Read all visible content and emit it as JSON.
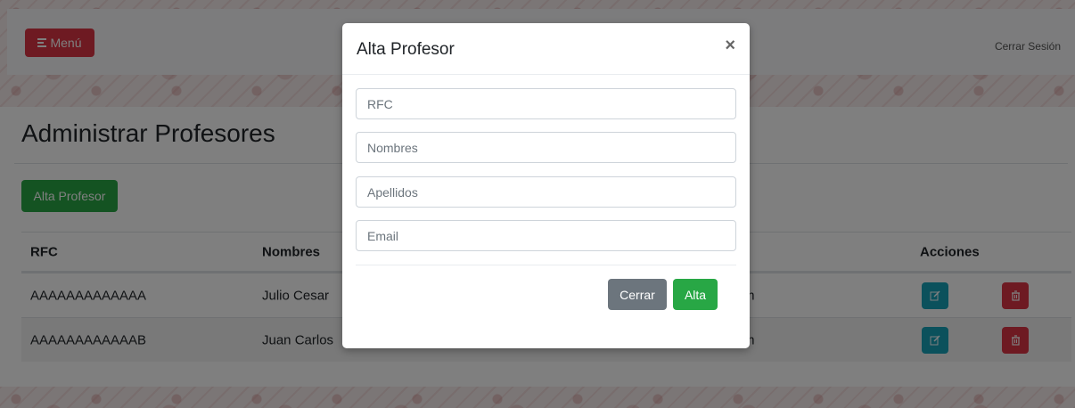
{
  "header": {
    "menu_label": "Menú",
    "logout_label": "Cerrar Sesión"
  },
  "page": {
    "title": "Administrar Profesores",
    "add_button_label": "Alta Profesor"
  },
  "table": {
    "headers": {
      "rfc": "RFC",
      "nombres": "Nombres",
      "acciones": "Acciones"
    },
    "rows": [
      {
        "rfc": "AAAAAAAAAAAAA",
        "nombres": "Julio Cesar",
        "email_fragment": "m"
      },
      {
        "rfc": "AAAAAAAAAAAAB",
        "nombres": "Juan Carlos",
        "email_fragment": "m"
      }
    ]
  },
  "modal": {
    "title": "Alta Profesor",
    "close_symbol": "×",
    "fields": {
      "rfc_placeholder": "RFC",
      "nombres_placeholder": "Nombres",
      "apellidos_placeholder": "Apellidos",
      "email_placeholder": "Email"
    },
    "cancel_label": "Cerrar",
    "submit_label": "Alta"
  },
  "icons": {
    "menu": "menu-icon",
    "edit": "edit-icon",
    "delete": "trash-icon",
    "close": "close-icon"
  },
  "colors": {
    "danger": "#dc3545",
    "success": "#28a745",
    "info": "#17a2b8",
    "secondary": "#6c757d"
  }
}
